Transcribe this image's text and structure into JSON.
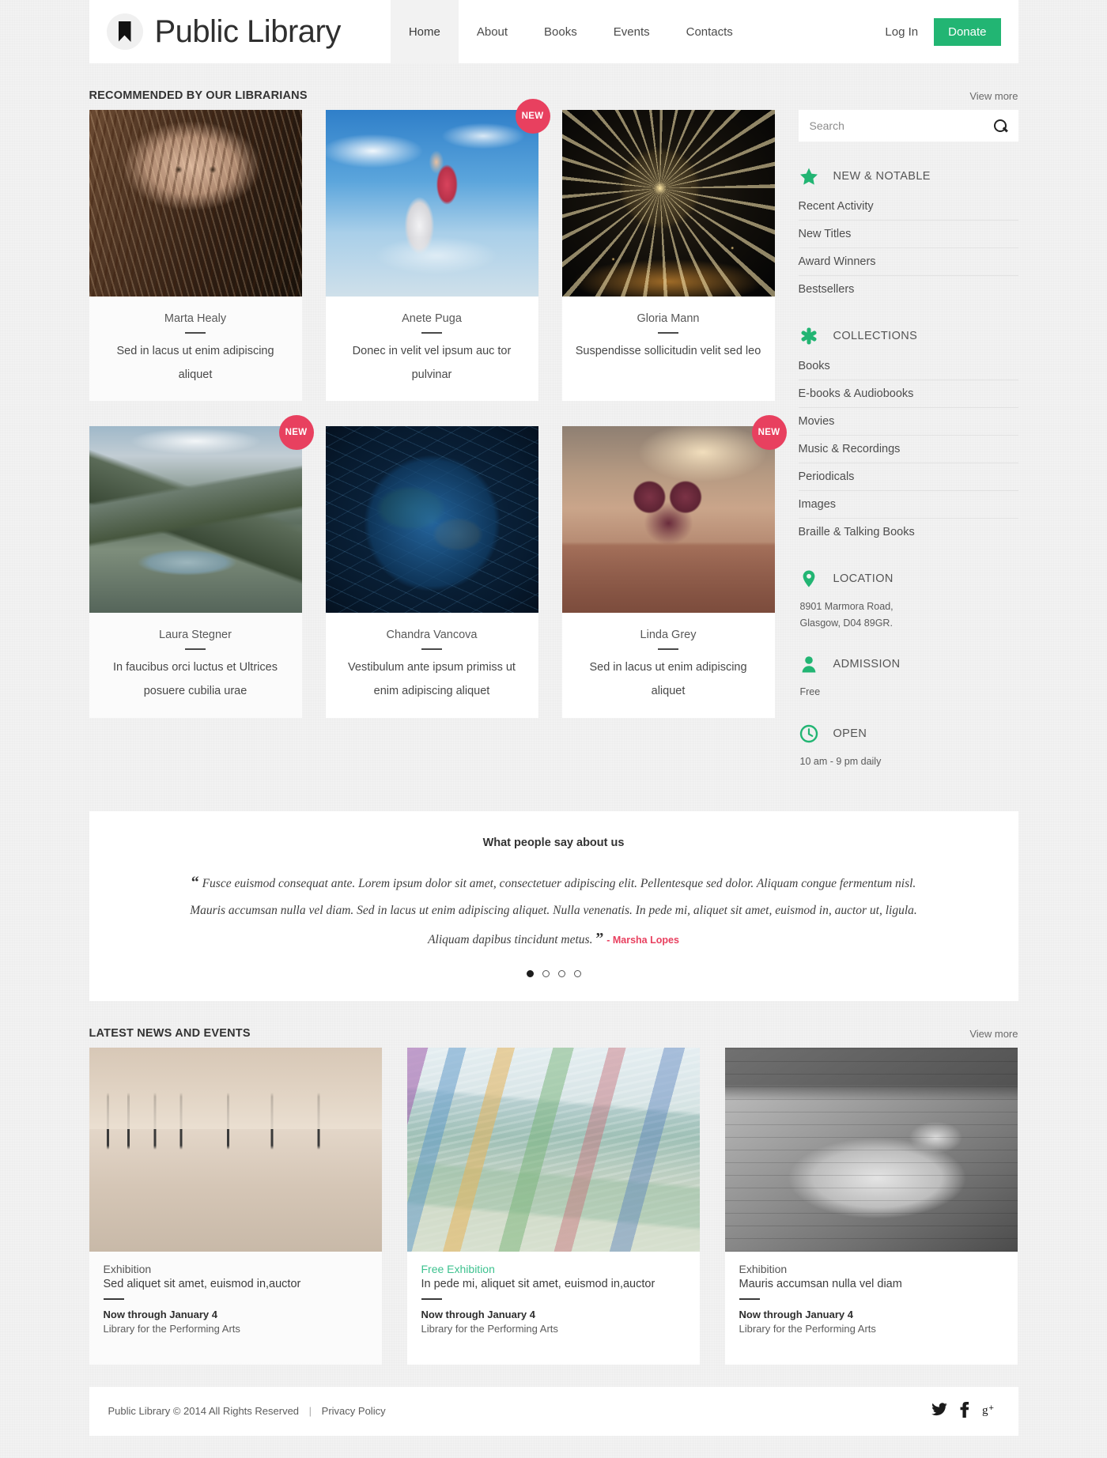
{
  "header": {
    "brand": "Public Library",
    "nav": [
      {
        "label": "Home",
        "active": true
      },
      {
        "label": "About",
        "active": false
      },
      {
        "label": "Books",
        "active": false
      },
      {
        "label": "Events",
        "active": false
      },
      {
        "label": "Contacts",
        "active": false
      }
    ],
    "login_label": "Log In",
    "donate_label": "Donate",
    "donate_color": "#22b573"
  },
  "recommended": {
    "title": "RECOMMENDED BY OUR LIBRARIANS",
    "view_more": "View more",
    "badge_label": "NEW",
    "badge_color": "#e8405f",
    "cards": [
      {
        "name": "Marta Healy",
        "desc": "Sed in lacus ut enim adipiscing aliquet",
        "new": false,
        "art": "art-portrait",
        "shade": true
      },
      {
        "name": "Anete Puga",
        "desc": "Donec in velit vel ipsum auc tor pulvinar",
        "new": true,
        "art": "art-sky",
        "shade": false
      },
      {
        "name": "Gloria Mann",
        "desc": "Suspendisse sollicitudin velit sed leo",
        "new": false,
        "art": "art-wheel",
        "shade": false
      },
      {
        "name": "Laura Stegner",
        "desc": "In faucibus orci luctus et Ultrices posuere cubilia urae",
        "new": true,
        "art": "art-lake",
        "shade": true
      },
      {
        "name": "Chandra Vancova",
        "desc": "Vestibulum ante ipsum primiss ut enim adipiscing aliquet",
        "new": false,
        "art": "art-globe",
        "shade": false
      },
      {
        "name": "Linda Grey",
        "desc": "Sed in lacus ut enim adipiscing aliquet",
        "new": true,
        "art": "art-tree",
        "shade": false
      }
    ]
  },
  "sidebar": {
    "search_placeholder": "Search",
    "search_value": "",
    "groups": [
      {
        "icon": "star-icon",
        "title": "NEW & NOTABLE",
        "items": [
          "Recent Activity",
          "New Titles",
          "Award Winners",
          "Bestsellers"
        ]
      },
      {
        "icon": "asterisk-icon",
        "title": "COLLECTIONS",
        "items": [
          "Books",
          "E-books & Audiobooks",
          "Movies",
          "Music & Recordings",
          "Periodicals",
          "Images",
          "Braille & Talking Books"
        ]
      }
    ],
    "info": [
      {
        "icon": "map-pin-icon",
        "title": "LOCATION",
        "text": "8901 Marmora Road,\nGlasgow, D04 89GR."
      },
      {
        "icon": "person-icon",
        "title": "ADMISSION",
        "text": "Free"
      },
      {
        "icon": "clock-icon",
        "title": "OPEN",
        "text": "10 am - 9 pm daily"
      }
    ],
    "accent_color": "#22b573"
  },
  "testimonial": {
    "title": "What people say about us",
    "quote_open": "“",
    "quote_close": "”",
    "text": "Fusce euismod consequat ante. Lorem ipsum dolor sit amet, consectetuer adipiscing elit. Pellentesque sed dolor. Aliquam congue fermentum nisl. Mauris accumsan nulla vel diam. Sed in lacus ut enim adipiscing aliquet. Nulla venenatis. In pede mi, aliquet sit amet, euismod in, auctor ut, ligula. Aliquam dapibus tincidunt metus.",
    "author": "- Marsha Lopes",
    "author_color": "#e8405f",
    "dots": 4,
    "active_dot": 0
  },
  "news": {
    "title": "LATEST NEWS AND EVENTS",
    "view_more": "View more",
    "cards": [
      {
        "kicker": "Exhibition",
        "free": false,
        "title": "Sed aliquet sit amet, euismod in,auctor",
        "date": "Now through January 4",
        "place": "Library for the Performing Arts",
        "art": "art-gallery",
        "shade": true
      },
      {
        "kicker": "Free Exhibition",
        "free": true,
        "title": "In pede mi, aliquet sit amet, euismod in,auctor",
        "date": "Now through January 4",
        "place": "Library for the Performing Arts",
        "art": "art-paint",
        "shade": false
      },
      {
        "kicker": "Exhibition",
        "free": false,
        "title": "Mauris accumsan nulla vel diam",
        "date": "Now through January 4",
        "place": "Library for the Performing Arts",
        "art": "art-statue",
        "shade": false
      }
    ],
    "free_color": "#3ec28f"
  },
  "footer": {
    "copyright": "Public Library © 2014 All Rights Reserved",
    "separator": "|",
    "privacy": "Privacy Policy",
    "social": [
      "twitter-icon",
      "facebook-icon",
      "googleplus-icon"
    ]
  }
}
